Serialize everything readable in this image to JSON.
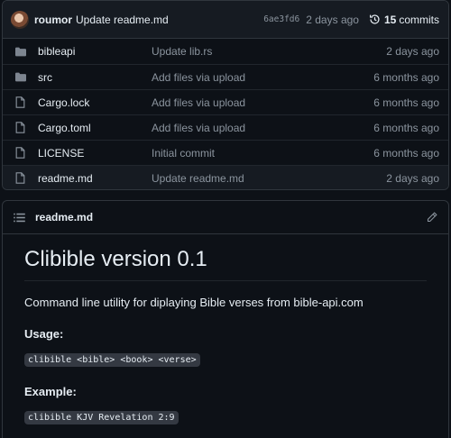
{
  "commit": {
    "author": "roumor",
    "message": "Update readme.md",
    "sha": "6ae3fd6",
    "date": "2 days ago",
    "commit_count": "15",
    "commits_label": "commits"
  },
  "files": [
    {
      "type": "folder",
      "name": "bibleapi",
      "message": "Update lib.rs",
      "date": "2 days ago"
    },
    {
      "type": "folder",
      "name": "src",
      "message": "Add files via upload",
      "date": "6 months ago"
    },
    {
      "type": "file",
      "name": "Cargo.lock",
      "message": "Add files via upload",
      "date": "6 months ago"
    },
    {
      "type": "file",
      "name": "Cargo.toml",
      "message": "Add files via upload",
      "date": "6 months ago"
    },
    {
      "type": "file",
      "name": "LICENSE",
      "message": "Initial commit",
      "date": "6 months ago"
    },
    {
      "type": "file",
      "name": "readme.md",
      "message": "Update readme.md",
      "date": "2 days ago"
    }
  ],
  "readme": {
    "filename": "readme.md",
    "heading": "Clibible version 0.1",
    "description": "Command line utility for diplaying Bible verses from bible-api.com",
    "usage_label": "Usage:",
    "usage_code": "clibible <bible> <book> <verse>",
    "example_label": "Example:",
    "example_code": "clibible KJV Revelation 2:9"
  },
  "colors": {
    "folder_icon": "#7d8590",
    "text": "#e6edf3",
    "muted": "#8b949e",
    "border": "#30363d"
  }
}
